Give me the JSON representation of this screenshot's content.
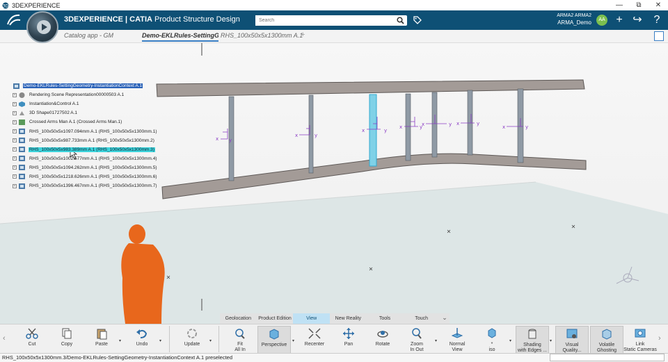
{
  "os": {
    "title": "3DEXPERIENCE",
    "controls": [
      "—",
      "⧉",
      "✕"
    ]
  },
  "header": {
    "brand_prefix": "3DEXPERIENCE | CATIA",
    "brand_app": "Product Structure Design",
    "search_placeholder": "Search",
    "user_name": "ARMA2 ARMA2",
    "user_role": "ARMA_Demo",
    "avatar_initials": "AA"
  },
  "tabs": [
    {
      "label": "Catalog app - GM"
    },
    {
      "label": "Demo-EKLRules-SettingGeo"
    },
    {
      "label": "RHS_100x50x5x1300mm A.1"
    },
    {
      "label": "+"
    }
  ],
  "tree": {
    "root": "Demo-EKLRules-SettingGeometry-InstantiationContext A.1",
    "items": [
      {
        "label": "Rendering Scene Representation00000503 A.1",
        "icon": "scene-icon"
      },
      {
        "label": "Instantiation&Control A.1",
        "icon": "control-icon"
      },
      {
        "label": "3D Shape01727502 A.1",
        "icon": "shape-icon"
      },
      {
        "label": "Crossed Arms Man A.1 (Crossed Arms Man.1)",
        "icon": "product-icon"
      },
      {
        "label": "RHS_100x50x5x1097.094mm A.1 (RHS_100x50x5x1300mm.1)",
        "icon": "part-icon"
      },
      {
        "label": "RHS_100x50x5x987.733mm A.1 (RHS_100x50x5x1300mm.2)",
        "icon": "part-icon"
      },
      {
        "label": "RHS_100x50x5x983.389mm A.1 (RHS_100x50x5x1300mm.3)",
        "icon": "part-icon",
        "preselected": true
      },
      {
        "label": "RHS_100x50x5x1002.577mm A.1 (RHS_100x50x5x1300mm.4)",
        "icon": "part-icon"
      },
      {
        "label": "RHS_100x50x5x1094.262mm A.1 (RHS_100x50x5x1300mm.5)",
        "icon": "part-icon"
      },
      {
        "label": "RHS_100x50x5x1218.626mm A.1 (RHS_100x50x5x1300mm.6)",
        "icon": "part-icon"
      },
      {
        "label": "RHS_100x50x5x1396.467mm A.1 (RHS_100x50x5x1300mm.7)",
        "icon": "part-icon"
      }
    ]
  },
  "section_tabs": [
    {
      "label": "Geolocation",
      "active": false
    },
    {
      "label": "Product Edition",
      "active": false
    },
    {
      "label": "View",
      "active": true
    },
    {
      "label": "New Reality",
      "active": false
    },
    {
      "label": "Tools",
      "active": false
    },
    {
      "label": "Touch",
      "active": false
    }
  ],
  "actions": {
    "cut": "Cut",
    "copy": "Copy",
    "paste": "Paste",
    "undo": "Undo",
    "update": "Update",
    "fit_all_1": "Fit",
    "fit_all_2": "All In",
    "perspective": "Perspective",
    "recenter": "Recenter",
    "pan": "Pan",
    "rotate": "Rotate",
    "zoom_1": "Zoom",
    "zoom_2": "In Out",
    "normal_1": "Normal",
    "normal_2": "View",
    "iso_1": "*",
    "iso_2": "iso",
    "shading_1": "Shading",
    "shading_2": "with Edges ...",
    "visual_1": "Visual",
    "visual_2": "Quality...",
    "ghost_1": "Volatile",
    "ghost_2": "Ghosting",
    "link_1": "Link",
    "link_2": "Static Cameras"
  },
  "axis_label": "x",
  "axis_label_y": "y",
  "status": {
    "text": "RHS_100x50x5x1300mm.3/Demo-EKLRules-SettingGeometry-InstantiationContext A.1 preselected"
  },
  "colors": {
    "header": "#0e5075",
    "accent": "#3a7fc4",
    "preselect": "#3dd4dc",
    "axis": "#8a3cc4",
    "human": "#e8671c"
  }
}
